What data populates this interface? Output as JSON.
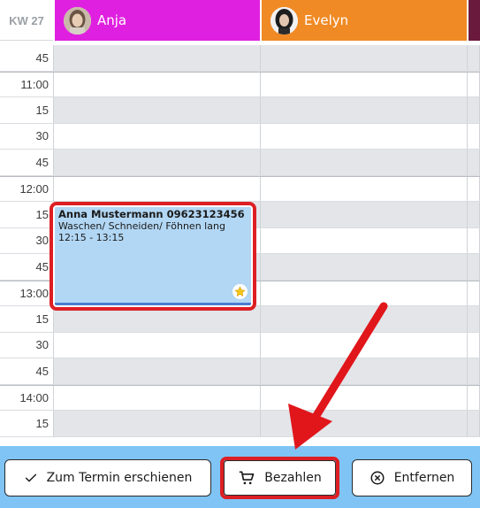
{
  "calendar": {
    "week_label": "KW 27",
    "columns": [
      {
        "name": "Anja",
        "color": "#e020e0"
      },
      {
        "name": "Evelyn",
        "color": "#f08a24"
      },
      {
        "name": "",
        "color": "#6a1a3c"
      }
    ],
    "time_labels": [
      "45",
      "11:00",
      "15",
      "30",
      "45",
      "12:00",
      "15",
      "30",
      "45",
      "13:00",
      "15",
      "30",
      "45",
      "14:00",
      "15"
    ]
  },
  "appointment": {
    "client": "Anna Mustermann  09623123456",
    "service": "Waschen/ Schneiden/ Föhnen lang",
    "time": "12:15 - 13:15",
    "color": "#b2d7f4",
    "badge_icon": "star-icon"
  },
  "actions": {
    "arrived_label": "Zum Termin erschienen",
    "arrived_icon": "check-icon",
    "pay_label": "Bezahlen",
    "pay_icon": "cart-icon",
    "remove_label": "Entfernen",
    "remove_icon": "close-circle-icon"
  },
  "highlight_color": "#dd1f23"
}
